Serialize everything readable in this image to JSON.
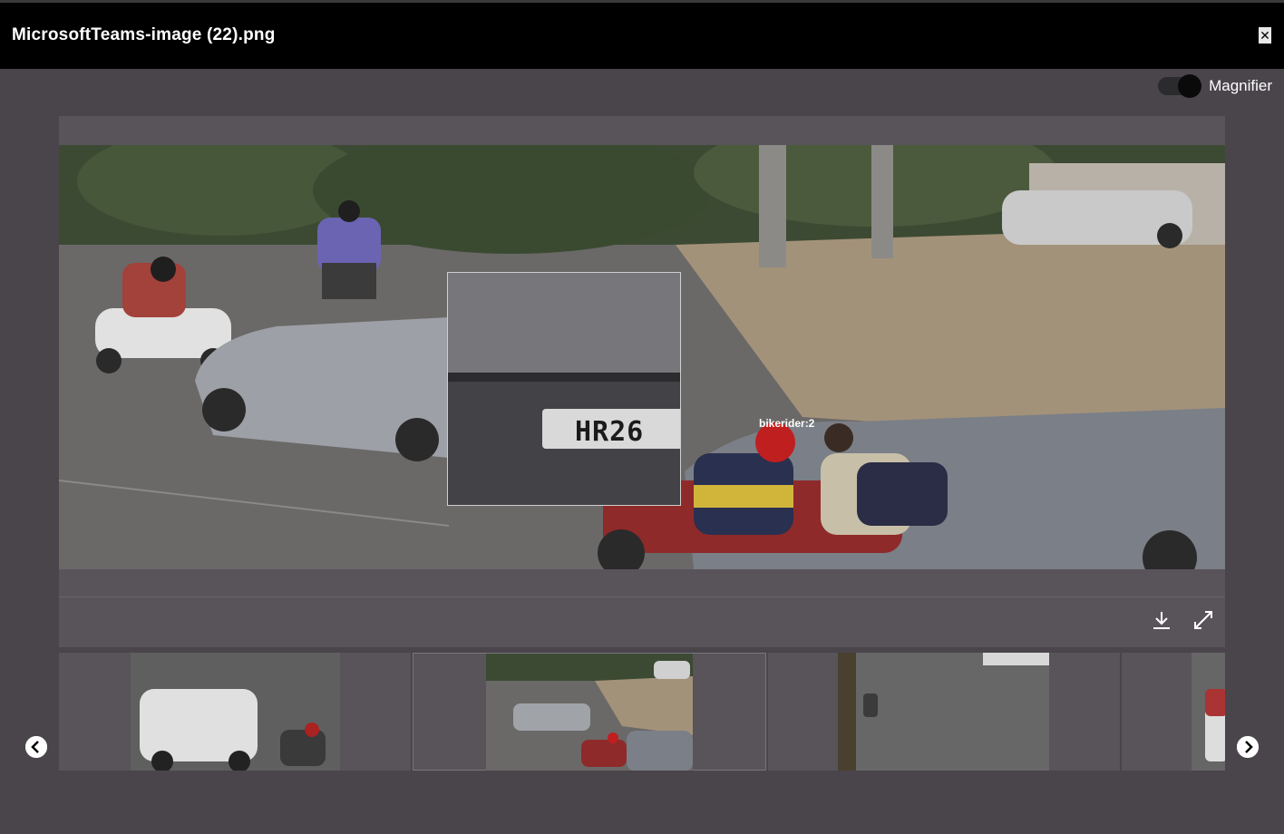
{
  "header": {
    "title": "MicrosoftTeams-image (22).png",
    "close_icon": "close-icon"
  },
  "magnifier": {
    "label": "Magnifier",
    "enabled": true
  },
  "viewer": {
    "detection_label": "bikerider:2",
    "magnified_plate_text": "HR26",
    "actions": [
      {
        "name": "download-button",
        "icon": "download-icon"
      },
      {
        "name": "fullscreen-button",
        "icon": "expand-icon"
      }
    ]
  },
  "thumbnails": {
    "count": 4,
    "active_index": 1,
    "prev_icon": "chevron-left-icon",
    "next_icon": "chevron-right-icon"
  },
  "colors": {
    "background": "#4a454b",
    "panel": "#59535a",
    "header": "#000000"
  }
}
